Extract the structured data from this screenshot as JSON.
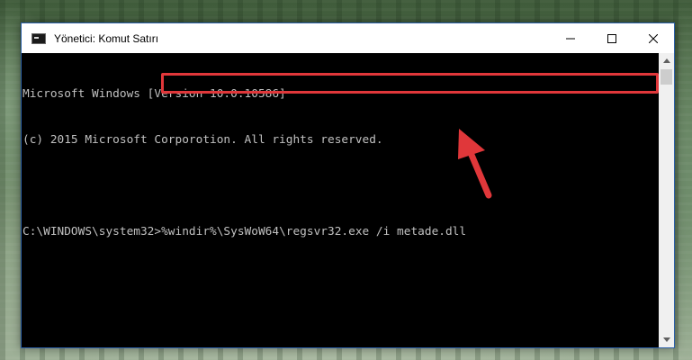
{
  "window": {
    "title": "Yönetici: Komut Satırı",
    "controls": {
      "minimize": "—",
      "maximize": "☐",
      "close": "✕"
    }
  },
  "console": {
    "lines": [
      "Microsoft Windows [Version 10.0.10586]",
      "(c) 2015 Microsoft Corporotion. All rights reserved.",
      "",
      ""
    ],
    "prompt": "C:\\WINDOWS\\system32>",
    "command": "%windir%\\SysWoW64\\regsvr32.exe /i metade.dll"
  },
  "colors": {
    "highlight": "#e0373a",
    "arrow": "#e0373a",
    "console_bg": "#000000",
    "console_text": "#c0c0c0"
  },
  "icons": {
    "app": "cmd-icon",
    "annotation": "red-arrow-icon"
  }
}
